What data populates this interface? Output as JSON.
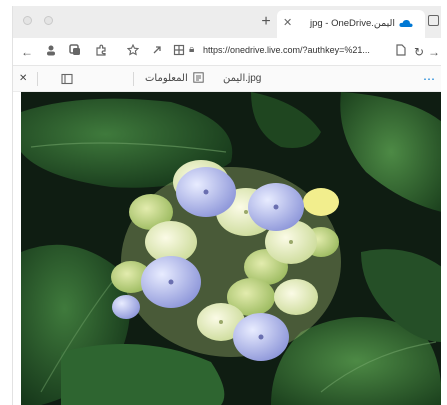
{
  "browser": {
    "tab": {
      "title": "اليمن.jpg - OneDrive",
      "favicon": "onedrive-cloud-icon"
    },
    "address": {
      "url": "https://onedrive.live.com/?authkey=%21..."
    },
    "icons": {
      "back": "back-arrow-icon",
      "refresh": "refresh-icon",
      "forward": "forward-arrow-icon",
      "new_tab": "plus-icon",
      "close_tab": "close-icon"
    }
  },
  "viewer": {
    "toolbar": {
      "file_name": "اليمن.jpg",
      "info_label": "المعلومات"
    },
    "image_alt": "hydrangea-photo"
  },
  "colors": {
    "tabstrip": "#ededed",
    "accent": "#0078d4",
    "photo_bg": "#0f1d12"
  }
}
